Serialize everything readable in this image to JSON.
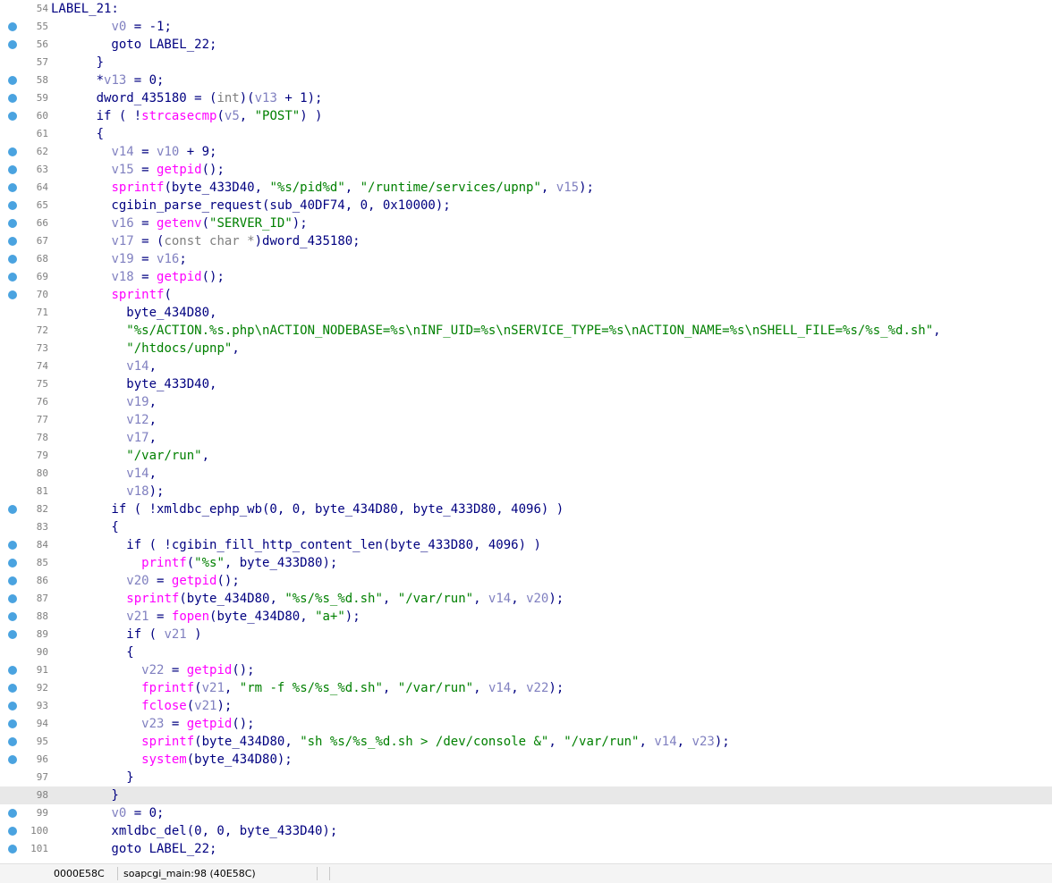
{
  "colors": {
    "plain": "#000080",
    "variable": "#8080c0",
    "function": "#ff00ff",
    "string": "#008000",
    "keyword": "#7f7f7f",
    "breakpoint": "#4aa3e0",
    "line_number": "#808080",
    "current_line_bg": "#e8e8e8"
  },
  "current_line": 98,
  "lines": [
    {
      "n": "54",
      "bp": false,
      "t": [
        [
          "p",
          "LABEL_21:"
        ]
      ]
    },
    {
      "n": "55",
      "bp": true,
      "t": [
        [
          "p",
          "        "
        ],
        [
          "v",
          "v0"
        ],
        [
          "p",
          " = -1;"
        ]
      ]
    },
    {
      "n": "56",
      "bp": true,
      "t": [
        [
          "p",
          "        goto LABEL_22;"
        ]
      ]
    },
    {
      "n": "57",
      "bp": false,
      "t": [
        [
          "p",
          "      }"
        ]
      ]
    },
    {
      "n": "58",
      "bp": true,
      "t": [
        [
          "p",
          "      *"
        ],
        [
          "v",
          "v13"
        ],
        [
          "p",
          " = 0;"
        ]
      ]
    },
    {
      "n": "59",
      "bp": true,
      "t": [
        [
          "p",
          "      dword_435180 = ("
        ],
        [
          "k",
          "int"
        ],
        [
          "p",
          ")("
        ],
        [
          "v",
          "v13"
        ],
        [
          "p",
          " + 1);"
        ]
      ]
    },
    {
      "n": "60",
      "bp": true,
      "t": [
        [
          "p",
          "      if ( !"
        ],
        [
          "f",
          "strcasecmp"
        ],
        [
          "p",
          "("
        ],
        [
          "v",
          "v5"
        ],
        [
          "p",
          ", "
        ],
        [
          "s",
          "\"POST\""
        ],
        [
          "p",
          ") )"
        ]
      ]
    },
    {
      "n": "61",
      "bp": false,
      "t": [
        [
          "p",
          "      {"
        ]
      ]
    },
    {
      "n": "62",
      "bp": true,
      "t": [
        [
          "p",
          "        "
        ],
        [
          "v",
          "v14"
        ],
        [
          "p",
          " = "
        ],
        [
          "v",
          "v10"
        ],
        [
          "p",
          " + 9;"
        ]
      ]
    },
    {
      "n": "63",
      "bp": true,
      "t": [
        [
          "p",
          "        "
        ],
        [
          "v",
          "v15"
        ],
        [
          "p",
          " = "
        ],
        [
          "f",
          "getpid"
        ],
        [
          "p",
          "();"
        ]
      ]
    },
    {
      "n": "64",
      "bp": true,
      "t": [
        [
          "p",
          "        "
        ],
        [
          "f",
          "sprintf"
        ],
        [
          "p",
          "(byte_433D40, "
        ],
        [
          "s",
          "\"%s/pid%d\""
        ],
        [
          "p",
          ", "
        ],
        [
          "s",
          "\"/runtime/services/upnp\""
        ],
        [
          "p",
          ", "
        ],
        [
          "v",
          "v15"
        ],
        [
          "p",
          ");"
        ]
      ]
    },
    {
      "n": "65",
      "bp": true,
      "t": [
        [
          "p",
          "        cgibin_parse_request(sub_40DF74, 0, 0x10000);"
        ]
      ]
    },
    {
      "n": "66",
      "bp": true,
      "t": [
        [
          "p",
          "        "
        ],
        [
          "v",
          "v16"
        ],
        [
          "p",
          " = "
        ],
        [
          "f",
          "getenv"
        ],
        [
          "p",
          "("
        ],
        [
          "s",
          "\"SERVER_ID\""
        ],
        [
          "p",
          ");"
        ]
      ]
    },
    {
      "n": "67",
      "bp": true,
      "t": [
        [
          "p",
          "        "
        ],
        [
          "v",
          "v17"
        ],
        [
          "p",
          " = ("
        ],
        [
          "k",
          "const char *"
        ],
        [
          "p",
          ")dword_435180;"
        ]
      ]
    },
    {
      "n": "68",
      "bp": true,
      "t": [
        [
          "p",
          "        "
        ],
        [
          "v",
          "v19"
        ],
        [
          "p",
          " = "
        ],
        [
          "v",
          "v16"
        ],
        [
          "p",
          ";"
        ]
      ]
    },
    {
      "n": "69",
      "bp": true,
      "t": [
        [
          "p",
          "        "
        ],
        [
          "v",
          "v18"
        ],
        [
          "p",
          " = "
        ],
        [
          "f",
          "getpid"
        ],
        [
          "p",
          "();"
        ]
      ]
    },
    {
      "n": "70",
      "bp": true,
      "t": [
        [
          "p",
          "        "
        ],
        [
          "f",
          "sprintf"
        ],
        [
          "p",
          "("
        ]
      ]
    },
    {
      "n": "71",
      "bp": false,
      "t": [
        [
          "p",
          "          byte_434D80,"
        ]
      ]
    },
    {
      "n": "72",
      "bp": false,
      "t": [
        [
          "p",
          "          "
        ],
        [
          "s",
          "\"%s/ACTION.%s.php\\nACTION_NODEBASE=%s\\nINF_UID=%s\\nSERVICE_TYPE=%s\\nACTION_NAME=%s\\nSHELL_FILE=%s/%s_%d.sh\""
        ],
        [
          "p",
          ","
        ]
      ]
    },
    {
      "n": "73",
      "bp": false,
      "t": [
        [
          "p",
          "          "
        ],
        [
          "s",
          "\"/htdocs/upnp\""
        ],
        [
          "p",
          ","
        ]
      ]
    },
    {
      "n": "74",
      "bp": false,
      "t": [
        [
          "p",
          "          "
        ],
        [
          "v",
          "v14"
        ],
        [
          "p",
          ","
        ]
      ]
    },
    {
      "n": "75",
      "bp": false,
      "t": [
        [
          "p",
          "          byte_433D40,"
        ]
      ]
    },
    {
      "n": "76",
      "bp": false,
      "t": [
        [
          "p",
          "          "
        ],
        [
          "v",
          "v19"
        ],
        [
          "p",
          ","
        ]
      ]
    },
    {
      "n": "77",
      "bp": false,
      "t": [
        [
          "p",
          "          "
        ],
        [
          "v",
          "v12"
        ],
        [
          "p",
          ","
        ]
      ]
    },
    {
      "n": "78",
      "bp": false,
      "t": [
        [
          "p",
          "          "
        ],
        [
          "v",
          "v17"
        ],
        [
          "p",
          ","
        ]
      ]
    },
    {
      "n": "79",
      "bp": false,
      "t": [
        [
          "p",
          "          "
        ],
        [
          "s",
          "\"/var/run\""
        ],
        [
          "p",
          ","
        ]
      ]
    },
    {
      "n": "80",
      "bp": false,
      "t": [
        [
          "p",
          "          "
        ],
        [
          "v",
          "v14"
        ],
        [
          "p",
          ","
        ]
      ]
    },
    {
      "n": "81",
      "bp": false,
      "t": [
        [
          "p",
          "          "
        ],
        [
          "v",
          "v18"
        ],
        [
          "p",
          ");"
        ]
      ]
    },
    {
      "n": "82",
      "bp": true,
      "t": [
        [
          "p",
          "        if ( !xmldbc_ephp_wb(0, 0, byte_434D80, byte_433D80, 4096) )"
        ]
      ]
    },
    {
      "n": "83",
      "bp": false,
      "t": [
        [
          "p",
          "        {"
        ]
      ]
    },
    {
      "n": "84",
      "bp": true,
      "t": [
        [
          "p",
          "          if ( !cgibin_fill_http_content_len(byte_433D80, 4096) )"
        ]
      ]
    },
    {
      "n": "85",
      "bp": true,
      "t": [
        [
          "p",
          "            "
        ],
        [
          "f",
          "printf"
        ],
        [
          "p",
          "("
        ],
        [
          "s",
          "\"%s\""
        ],
        [
          "p",
          ", byte_433D80);"
        ]
      ]
    },
    {
      "n": "86",
      "bp": true,
      "t": [
        [
          "p",
          "          "
        ],
        [
          "v",
          "v20"
        ],
        [
          "p",
          " = "
        ],
        [
          "f",
          "getpid"
        ],
        [
          "p",
          "();"
        ]
      ]
    },
    {
      "n": "87",
      "bp": true,
      "t": [
        [
          "p",
          "          "
        ],
        [
          "f",
          "sprintf"
        ],
        [
          "p",
          "(byte_434D80, "
        ],
        [
          "s",
          "\"%s/%s_%d.sh\""
        ],
        [
          "p",
          ", "
        ],
        [
          "s",
          "\"/var/run\""
        ],
        [
          "p",
          ", "
        ],
        [
          "v",
          "v14"
        ],
        [
          "p",
          ", "
        ],
        [
          "v",
          "v20"
        ],
        [
          "p",
          ");"
        ]
      ]
    },
    {
      "n": "88",
      "bp": true,
      "t": [
        [
          "p",
          "          "
        ],
        [
          "v",
          "v21"
        ],
        [
          "p",
          " = "
        ],
        [
          "f",
          "fopen"
        ],
        [
          "p",
          "(byte_434D80, "
        ],
        [
          "s",
          "\"a+\""
        ],
        [
          "p",
          ");"
        ]
      ]
    },
    {
      "n": "89",
      "bp": true,
      "t": [
        [
          "p",
          "          if ( "
        ],
        [
          "v",
          "v21"
        ],
        [
          "p",
          " )"
        ]
      ]
    },
    {
      "n": "90",
      "bp": false,
      "t": [
        [
          "p",
          "          {"
        ]
      ]
    },
    {
      "n": "91",
      "bp": true,
      "t": [
        [
          "p",
          "            "
        ],
        [
          "v",
          "v22"
        ],
        [
          "p",
          " = "
        ],
        [
          "f",
          "getpid"
        ],
        [
          "p",
          "();"
        ]
      ]
    },
    {
      "n": "92",
      "bp": true,
      "t": [
        [
          "p",
          "            "
        ],
        [
          "f",
          "fprintf"
        ],
        [
          "p",
          "("
        ],
        [
          "v",
          "v21"
        ],
        [
          "p",
          ", "
        ],
        [
          "s",
          "\"rm -f %s/%s_%d.sh\""
        ],
        [
          "p",
          ", "
        ],
        [
          "s",
          "\"/var/run\""
        ],
        [
          "p",
          ", "
        ],
        [
          "v",
          "v14"
        ],
        [
          "p",
          ", "
        ],
        [
          "v",
          "v22"
        ],
        [
          "p",
          ");"
        ]
      ]
    },
    {
      "n": "93",
      "bp": true,
      "t": [
        [
          "p",
          "            "
        ],
        [
          "f",
          "fclose"
        ],
        [
          "p",
          "("
        ],
        [
          "v",
          "v21"
        ],
        [
          "p",
          ");"
        ]
      ]
    },
    {
      "n": "94",
      "bp": true,
      "t": [
        [
          "p",
          "            "
        ],
        [
          "v",
          "v23"
        ],
        [
          "p",
          " = "
        ],
        [
          "f",
          "getpid"
        ],
        [
          "p",
          "();"
        ]
      ]
    },
    {
      "n": "95",
      "bp": true,
      "t": [
        [
          "p",
          "            "
        ],
        [
          "f",
          "sprintf"
        ],
        [
          "p",
          "(byte_434D80, "
        ],
        [
          "s",
          "\"sh %s/%s_%d.sh > /dev/console &\""
        ],
        [
          "p",
          ", "
        ],
        [
          "s",
          "\"/var/run\""
        ],
        [
          "p",
          ", "
        ],
        [
          "v",
          "v14"
        ],
        [
          "p",
          ", "
        ],
        [
          "v",
          "v23"
        ],
        [
          "p",
          ");"
        ]
      ]
    },
    {
      "n": "96",
      "bp": true,
      "t": [
        [
          "p",
          "            "
        ],
        [
          "f",
          "system"
        ],
        [
          "p",
          "(byte_434D80);"
        ]
      ]
    },
    {
      "n": "97",
      "bp": false,
      "t": [
        [
          "p",
          "          }"
        ]
      ]
    },
    {
      "n": "98",
      "bp": false,
      "t": [
        [
          "p",
          "        }"
        ]
      ]
    },
    {
      "n": "99",
      "bp": true,
      "t": [
        [
          "p",
          "        "
        ],
        [
          "v",
          "v0"
        ],
        [
          "p",
          " = 0;"
        ]
      ]
    },
    {
      "n": "100",
      "bp": true,
      "t": [
        [
          "p",
          "        xmldbc_del(0, 0, byte_433D40);"
        ]
      ]
    },
    {
      "n": "101",
      "bp": true,
      "t": [
        [
          "p",
          "        goto LABEL_22;"
        ]
      ]
    }
  ],
  "status": {
    "address": "0000E58C",
    "location": "soapcgi_main:98 (40E58C)"
  }
}
